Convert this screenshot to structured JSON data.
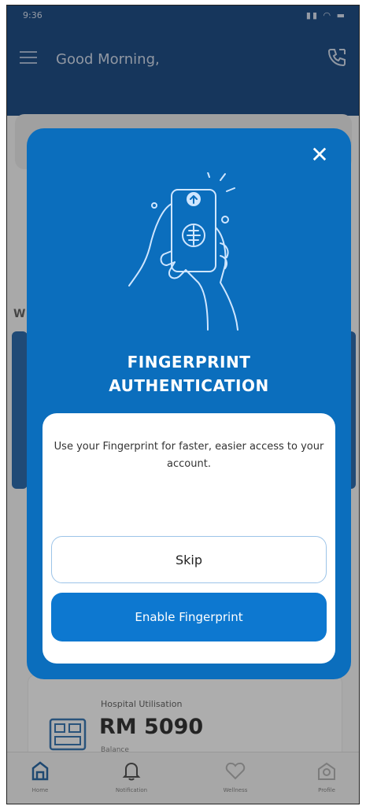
{
  "app": {
    "status_time": "9:36",
    "status_icons": "signal-wifi-battery",
    "greeting": "Good Morning,"
  },
  "background": {
    "section_letter": "W",
    "hospital_card": {
      "label": "Hospital Utilisation",
      "amount": "RM 5090",
      "sub": "Balance"
    }
  },
  "modal": {
    "title_line1": "FINGERPRINT",
    "title_line2": "AUTHENTICATION",
    "description": "Use your Fingerprint for faster, easier access to your account.",
    "skip_label": "Skip",
    "enable_label": "Enable Fingerprint",
    "close_icon": "close-icon"
  },
  "navbar": {
    "items": [
      {
        "label": "Home",
        "icon": "home-icon"
      },
      {
        "label": "Notification",
        "icon": "bell-icon"
      },
      {
        "label": "Wellness",
        "icon": "heart-icon"
      },
      {
        "label": "Profile",
        "icon": "profile-icon"
      }
    ]
  },
  "colors": {
    "header": "#0d3e79",
    "modal": "#0b6ebd",
    "primary_button": "#0d78d0"
  }
}
